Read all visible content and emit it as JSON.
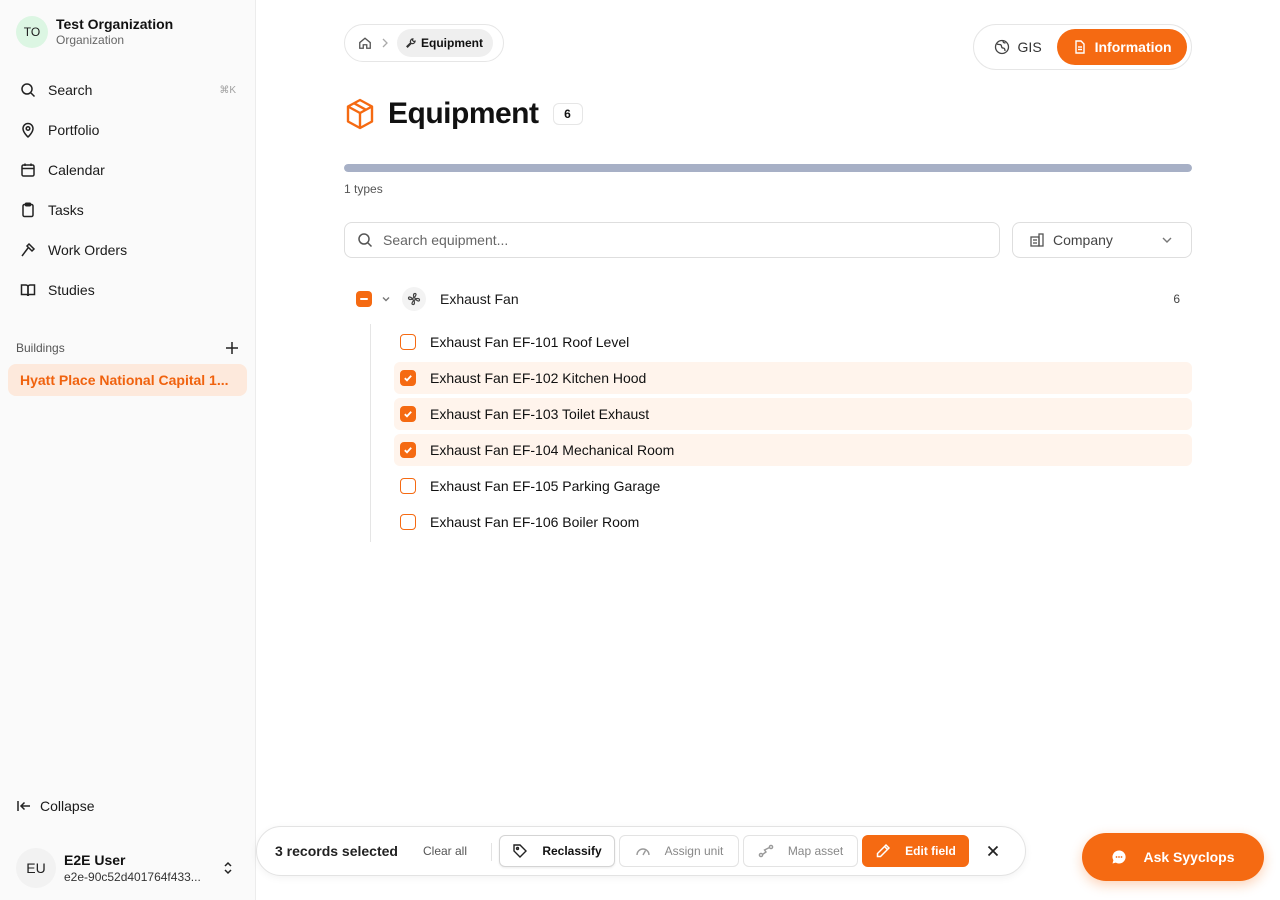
{
  "org": {
    "initials": "TO",
    "name": "Test Organization",
    "subtitle": "Organization"
  },
  "nav": [
    {
      "label": "Search",
      "icon": "search-icon",
      "shortcut": "⌘K"
    },
    {
      "label": "Portfolio",
      "icon": "map-pin-icon"
    },
    {
      "label": "Calendar",
      "icon": "calendar-icon"
    },
    {
      "label": "Tasks",
      "icon": "clipboard-icon"
    },
    {
      "label": "Work Orders",
      "icon": "hammer-icon"
    },
    {
      "label": "Studies",
      "icon": "book-icon"
    }
  ],
  "buildings": {
    "label": "Buildings",
    "items": [
      "Hyatt Place National Capital 1..."
    ]
  },
  "collapse_label": "Collapse",
  "user": {
    "initials": "EU",
    "name": "E2E User",
    "id": "e2e-90c52d401764f433..."
  },
  "breadcrumb": {
    "current": "Equipment"
  },
  "view_toggle": {
    "gis": "GIS",
    "information": "Information",
    "active": "information"
  },
  "page": {
    "title": "Equipment",
    "count": "6",
    "types_label": "1 types",
    "progress": 1.0
  },
  "search": {
    "placeholder": "Search equipment...",
    "value": ""
  },
  "filter": {
    "label": "Company"
  },
  "group": {
    "name": "Exhaust Fan",
    "count": "6",
    "state": "indeterminate"
  },
  "items": [
    {
      "label": "Exhaust Fan EF-101 Roof Level",
      "checked": false
    },
    {
      "label": "Exhaust Fan EF-102 Kitchen Hood",
      "checked": true
    },
    {
      "label": "Exhaust Fan EF-103 Toilet Exhaust",
      "checked": true
    },
    {
      "label": "Exhaust Fan EF-104 Mechanical Room",
      "checked": true
    },
    {
      "label": "Exhaust Fan EF-105 Parking Garage",
      "checked": false
    },
    {
      "label": "Exhaust Fan EF-106 Boiler Room",
      "checked": false
    }
  ],
  "actionbar": {
    "selected": "3 records selected",
    "clear": "Clear all",
    "reclassify": "Reclassify",
    "assign_unit": "Assign unit",
    "map_asset": "Map asset",
    "edit_field": "Edit field"
  },
  "assistant": {
    "label": "Ask Syyclops"
  },
  "colors": {
    "accent": "#f56a12",
    "accent_soft": "#fde9dc",
    "row_selected": "#fff4ec"
  }
}
